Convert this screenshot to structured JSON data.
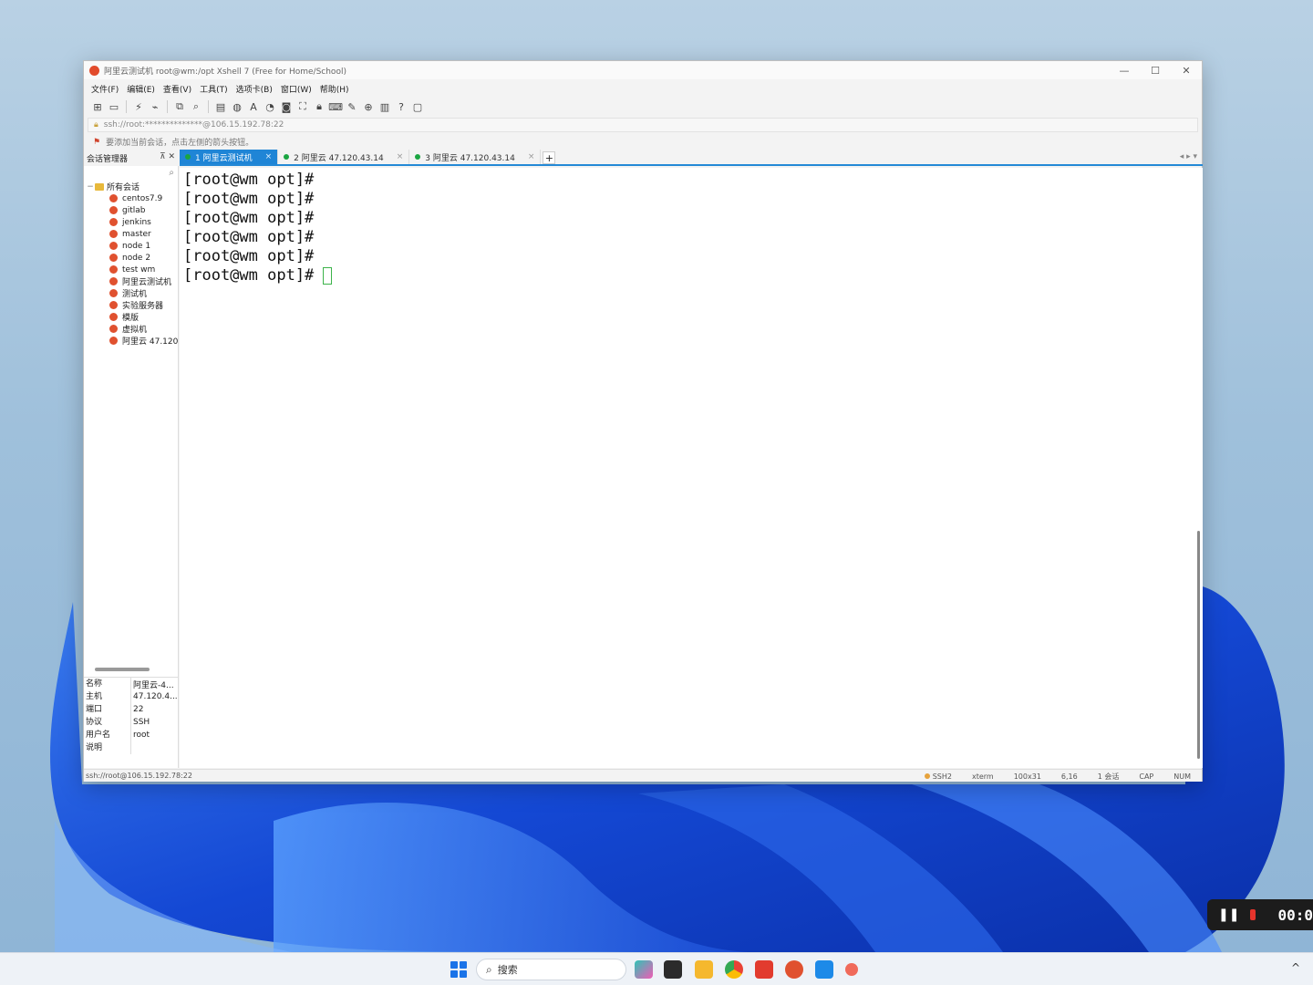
{
  "window": {
    "title": "阿里云测试机   root@wm:/opt   Xshell 7 (Free for Home/School)",
    "controls": {
      "minimize": "—",
      "maximize": "☐",
      "close": "✕"
    }
  },
  "menu": [
    "文件(F)",
    "编辑(E)",
    "查看(V)",
    "工具(T)",
    "选项卡(B)",
    "窗口(W)",
    "帮助(H)"
  ],
  "address": {
    "text": "ssh://root:**************@106.15.192.78:22"
  },
  "hint": {
    "text": "要添加当前会话，点击左侧的箭头按钮。"
  },
  "session_manager": {
    "title": "会话管理器",
    "pin": "⊼",
    "close": "✕",
    "root": "所有会话",
    "items": [
      "centos7.9",
      "gitlab",
      "jenkins",
      "master",
      "node 1",
      "node 2",
      "test wm",
      "阿里云测试机",
      "测试机",
      "实验服务器",
      "模版",
      "虚拟机",
      "阿里云 47.120"
    ]
  },
  "tabs": [
    {
      "label": "1 阿里云测试机",
      "close": "×"
    },
    {
      "label": "2 阿里云 47.120.43.14",
      "close": "×"
    },
    {
      "label": "3 阿里云 47.120.43.14",
      "close": "×"
    }
  ],
  "tab_add": "+",
  "tab_nav": "◂ ▸ ▾",
  "properties": [
    {
      "key": "名称",
      "value": "阿里云-4..."
    },
    {
      "key": "主机",
      "value": "47.120.4..."
    },
    {
      "key": "端口",
      "value": "22"
    },
    {
      "key": "协议",
      "value": "SSH"
    },
    {
      "key": "用户名",
      "value": "root"
    },
    {
      "key": "说明",
      "value": ""
    }
  ],
  "terminal": {
    "lines": [
      "[root@wm opt]#",
      "[root@wm opt]#",
      "[root@wm opt]#",
      "[root@wm opt]#",
      "[root@wm opt]#",
      "[root@wm opt]#"
    ]
  },
  "status": {
    "left": "ssh://root@106.15.192.78:22",
    "protocol": "SSH2",
    "term": "xterm",
    "size": "100x31",
    "cursor": "6,16",
    "sessions": "1 会话",
    "cap": "CAP",
    "num": "NUM"
  },
  "taskbar": {
    "search_placeholder": "搜索"
  },
  "recorder": {
    "time": "00:0"
  },
  "colors": {
    "accent": "#1f85d6",
    "session_icon": "#e0512f",
    "online_dot": "#1aa541"
  }
}
